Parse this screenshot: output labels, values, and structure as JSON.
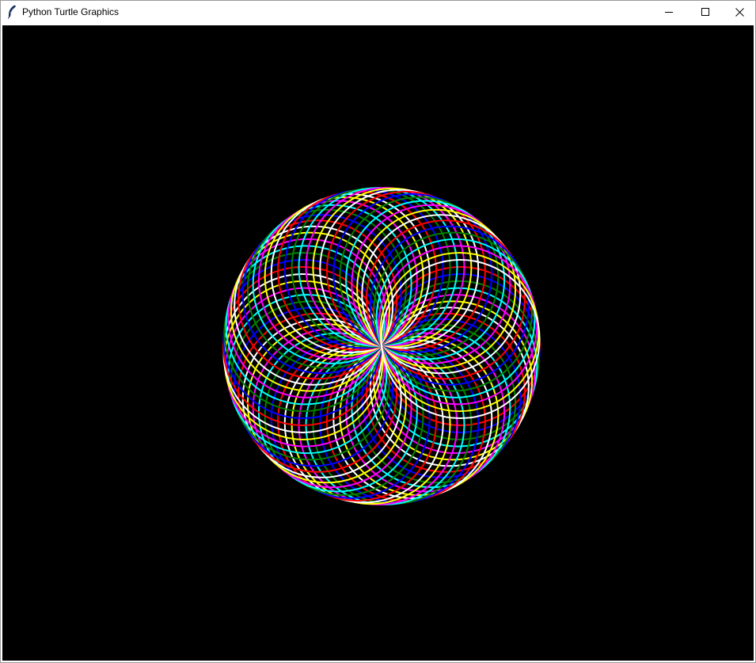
{
  "window": {
    "title": "Python Turtle Graphics",
    "app_icon": "feather-icon",
    "controls": {
      "minimize": "minimize-icon",
      "maximize": "maximize-icon",
      "close": "close-icon"
    }
  },
  "canvas": {
    "background": "#000000",
    "pen_colors": [
      "#ff0000",
      "#0000ff",
      "#008000",
      "#00ffff",
      "#ff00ff",
      "#ffff00",
      "#ffffff"
    ]
  }
}
